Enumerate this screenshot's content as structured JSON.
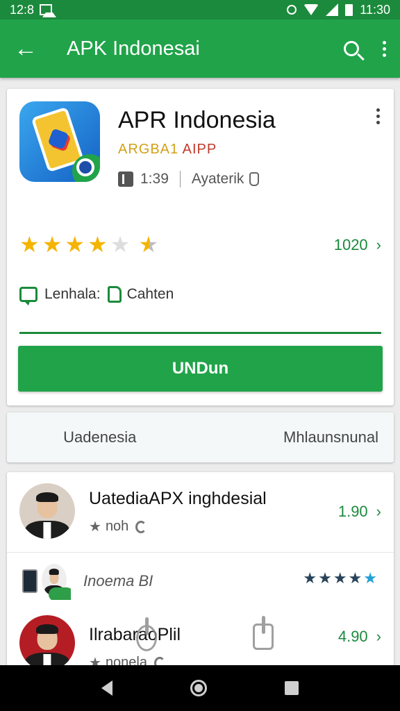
{
  "status_bar": {
    "time_left": "12:8",
    "time_right": "11:30"
  },
  "app_bar": {
    "title": "APK Indonesai"
  },
  "app_card": {
    "name": "APR Indonesia",
    "developer_a": "ARGBA1",
    "developer_b": "AIPP",
    "meta_version": "1:39",
    "meta_label": "Ayaterik",
    "rating_stars": 3.5,
    "rating_count": "1020",
    "links_label_1": "Lenhala:",
    "links_label_2": "Cahten",
    "install_label": "UNDun"
  },
  "tabs": {
    "left": "Uadenesia",
    "right": "Mhlaunsnunal"
  },
  "list": {
    "row1": {
      "title": "UatediaAPX inghdesial",
      "sub": "noh",
      "value": "1.90"
    },
    "row2": {
      "title": "Inoema BI"
    },
    "row3": {
      "title": "IlrabaraoPlil",
      "sub": "nonela",
      "value": "4.90"
    }
  },
  "colors": {
    "primary": "#21a34a",
    "primary_dark": "#1b8a3c",
    "star": "#f4b400"
  }
}
